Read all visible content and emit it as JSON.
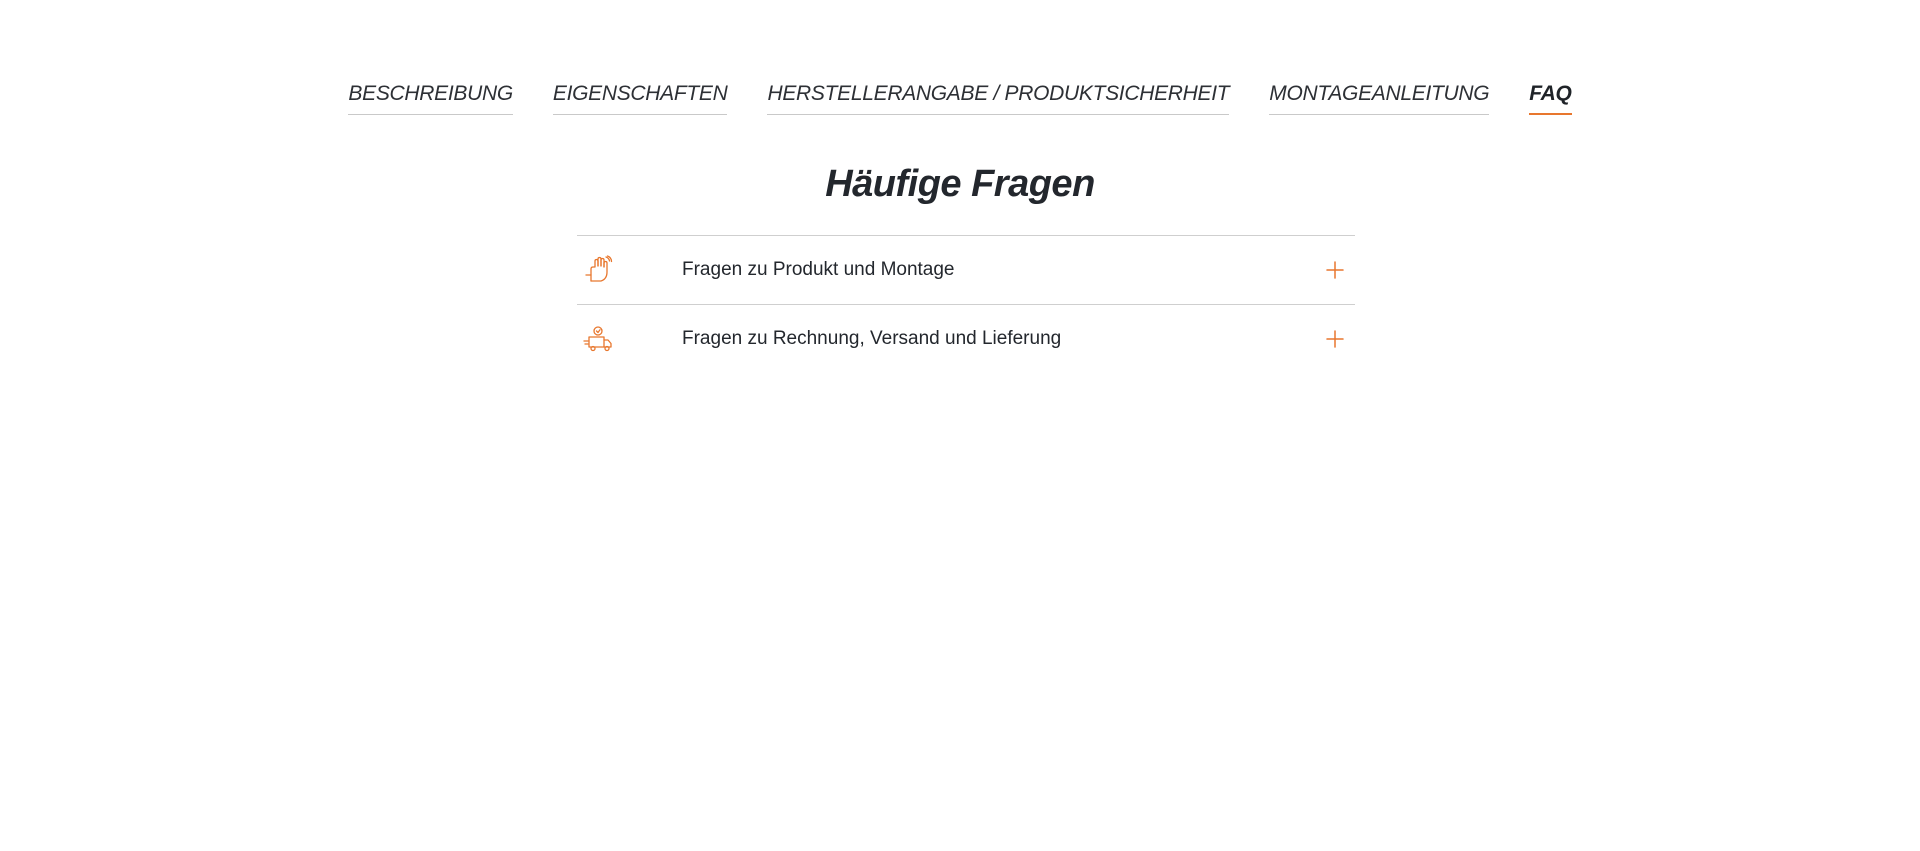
{
  "tabs": [
    {
      "label": "BESCHREIBUNG",
      "active": false
    },
    {
      "label": "EIGENSCHAFTEN",
      "active": false
    },
    {
      "label": "HERSTELLERANGABE / PRODUKTSICHERHEIT",
      "active": false
    },
    {
      "label": "MONTAGEANLEITUNG",
      "active": false
    },
    {
      "label": "FAQ",
      "active": true
    }
  ],
  "faq": {
    "title": "Häufige Fragen",
    "items": [
      {
        "label": "Fragen zu Produkt und Montage",
        "icon": "waving-hand-icon",
        "toggle_icon": "plus-icon"
      },
      {
        "label": "Fragen zu Rechnung, Versand und Lieferung",
        "icon": "delivery-truck-icon",
        "toggle_icon": "plus-icon"
      }
    ]
  },
  "colors": {
    "accent": "#e8772e",
    "text": "#23272d",
    "divider": "#cfcfcf"
  }
}
